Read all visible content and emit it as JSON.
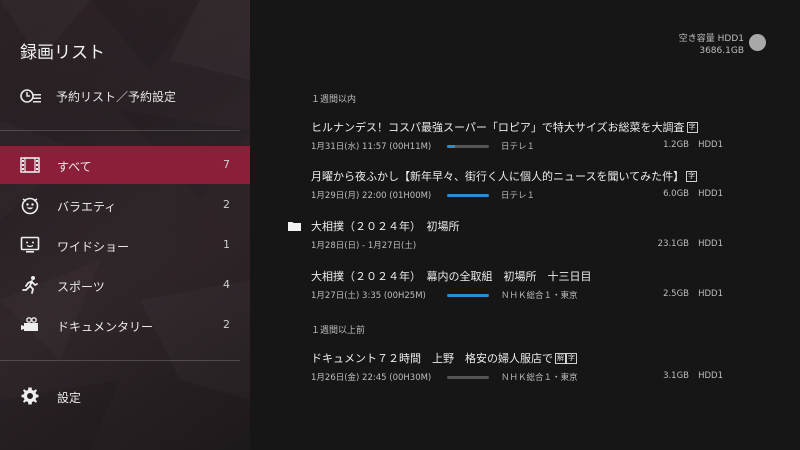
{
  "sidebar": {
    "title": "録画リスト",
    "schedule_label": "予約リスト／予約設定",
    "items": [
      {
        "label": "すべて",
        "count": "7",
        "icon": "film-icon"
      },
      {
        "label": "バラエティ",
        "count": "2",
        "icon": "smiley-icon"
      },
      {
        "label": "ワイドショー",
        "count": "1",
        "icon": "tv-icon"
      },
      {
        "label": "スポーツ",
        "count": "4",
        "icon": "runner-icon"
      },
      {
        "label": "ドキュメンタリー",
        "count": "2",
        "icon": "camera-icon"
      }
    ],
    "settings_label": "設定"
  },
  "storage": {
    "label": "空き容量 HDD1",
    "value": "3686.1GB"
  },
  "sections": [
    {
      "header": "１週間以内"
    },
    {
      "header": "１週間以上前"
    }
  ],
  "recordings": [
    {
      "title": "ヒルナンデス！コスパ最強スーパー「ロピア」で特大サイズお総菜を大調査",
      "badges": [
        "字"
      ],
      "date": "1月31日(水) 11:57 (00H11M)",
      "progress": 0.2,
      "channel": "日テレ１",
      "size": "1.2GB",
      "drive": "HDD1"
    },
    {
      "title": "月曜から夜ふかし【新年早々、街行く人に個人的ニュースを聞いてみた件】",
      "badges": [
        "字"
      ],
      "date": "1月29日(月) 22:00 (01H00M)",
      "progress": 1.0,
      "channel": "日テレ１",
      "size": "6.0GB",
      "drive": "HDD1"
    },
    {
      "title": "大相撲（２０２４年）　初場所",
      "badges": [],
      "date": "1月28日(日) - 1月27日(土)",
      "folder": true,
      "size": "23.1GB",
      "drive": "HDD1"
    },
    {
      "title": "大相撲（２０２４年）　幕内の全取組　初場所　十三日目",
      "badges": [],
      "date": "1月27日(土) 3:35 (00H25M)",
      "progress": 1.0,
      "channel": "ＮＨＫ総合１・東京",
      "size": "2.5GB",
      "drive": "HDD1"
    },
    {
      "title": "ドキュメント７２時間　上野　格安の婦人服店で",
      "badges": [
        "解",
        "字"
      ],
      "date": "1月26日(金) 22:45 (00H30M)",
      "progress": 0.0,
      "channel": "ＮＨＫ総合１・東京",
      "size": "3.1GB",
      "drive": "HDD1"
    }
  ],
  "colors": {
    "accent": "#8b1f3a",
    "progress": "#2a8bd0"
  }
}
